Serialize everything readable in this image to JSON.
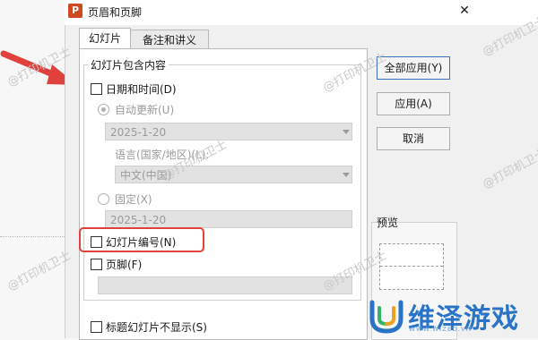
{
  "window": {
    "title": "页眉和页脚",
    "app_icon_letter": "P"
  },
  "tabs": [
    {
      "label": "幻灯片",
      "active": true
    },
    {
      "label": "备注和讲义",
      "active": false
    }
  ],
  "group": {
    "legend": "幻灯片包含内容"
  },
  "date_time": {
    "label": "日期和时间(D)",
    "auto_update_label": "自动更新(U)",
    "auto_date_value": "2025-1-20",
    "language_label": "语言(国家/地区)(L):",
    "language_value": "中文(中国)",
    "fixed_label": "固定(X)",
    "fixed_value": "2025-1-20"
  },
  "slide_number": {
    "label": "幻灯片编号(N)"
  },
  "footer": {
    "label": "页脚(F)",
    "value": ""
  },
  "hide_title_slide": {
    "label": "标题幻灯片不显示(S)"
  },
  "buttons": {
    "apply_all": "全部应用(Y)",
    "apply": "应用(A)",
    "cancel": "取消"
  },
  "preview": {
    "label": "预览"
  },
  "watermark": "@打印机卫士",
  "brand": {
    "name": "维泽游戏",
    "sub": "WWW.WIZED.VIP"
  },
  "colors": {
    "annotation_red": "#e0413d",
    "brand_blue": "#2a74c7",
    "dialog_bg": "#f0f0f0"
  }
}
